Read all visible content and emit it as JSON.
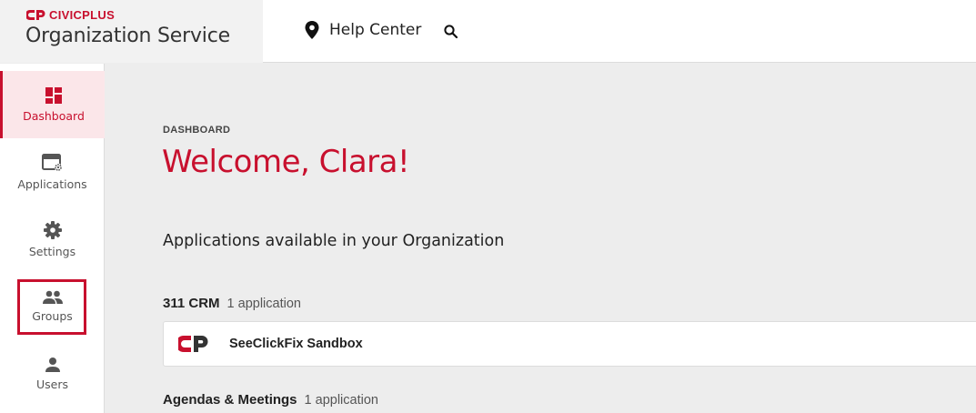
{
  "brand": {
    "logo_text": "CIVICPLUS",
    "app_title": "Organization Service",
    "accent_color": "#c8102e"
  },
  "header": {
    "help_label": "Help Center",
    "help_icon": "location-pin-icon",
    "search_icon": "search-icon"
  },
  "sidebar": {
    "items": [
      {
        "label": "Dashboard",
        "icon": "dashboard-icon",
        "active": true
      },
      {
        "label": "Applications",
        "icon": "applications-icon",
        "active": false
      },
      {
        "label": "Settings",
        "icon": "gear-icon",
        "active": false
      },
      {
        "label": "Groups",
        "icon": "groups-icon",
        "active": false,
        "highlighted": true
      },
      {
        "label": "Users",
        "icon": "user-icon",
        "active": false
      }
    ]
  },
  "main": {
    "breadcrumb": "DASHBOARD",
    "welcome": "Welcome, Clara!",
    "section_title": "Applications available in your Organization",
    "categories": [
      {
        "name": "311 CRM",
        "count": "1 application",
        "apps": [
          {
            "name": "SeeClickFix Sandbox"
          }
        ]
      },
      {
        "name": "Agendas & Meetings",
        "count": "1 application",
        "apps": []
      }
    ]
  }
}
